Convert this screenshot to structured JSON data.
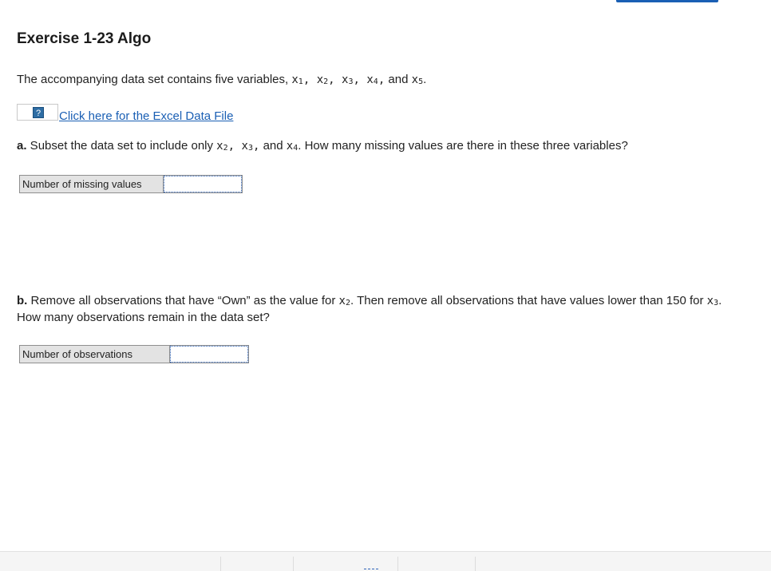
{
  "exercise": {
    "title": "Exercise 1-23 Algo"
  },
  "intro": {
    "prefix": "The accompanying data set contains five variables, ",
    "vars": [
      "x",
      "x",
      "x",
      "x",
      "x"
    ],
    "subs": [
      "1",
      "2",
      "3",
      "4",
      "5"
    ],
    "sep": ", ",
    "and": " and ",
    "end": "."
  },
  "file": {
    "help_glyph": "?",
    "link_text": "Click here for the Excel Data File"
  },
  "part_a": {
    "letter": "a.",
    "text_before": " Subset the data set to include only ",
    "var2": "x",
    "sub2": "2",
    "var3": "x",
    "sub3": "3",
    "var4": "x",
    "sub4": "4",
    "sep": ", ",
    "and": " and ",
    "text_after": ". How many missing values are there in these three variables?",
    "answer_label": "Number of missing values",
    "answer_value": ""
  },
  "part_b": {
    "letter": "b.",
    "text_before": " Remove all observations that have “Own” as the value for ",
    "var2": "x",
    "sub2": "2",
    "text_middle": ". Then remove all observations that have values lower than 150 for ",
    "var3": "x",
    "sub3": "3",
    "text_after": ". How many observations remain in the data set?",
    "answer_label": "Number of observations",
    "answer_value": ""
  },
  "colors": {
    "link": "#1a5fb4",
    "label_bg": "#e3e3e3",
    "input_border": "#2e63b8"
  },
  "icons": [
    "help-icon"
  ]
}
